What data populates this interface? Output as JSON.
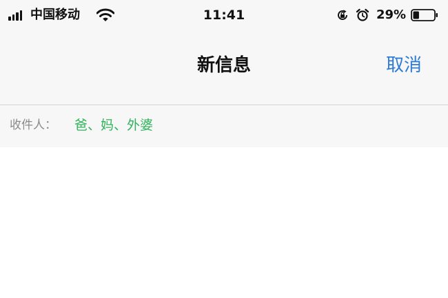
{
  "status_bar": {
    "carrier": "中国移动",
    "time": "11:41",
    "battery_percent": "29%",
    "battery_level": 0.29,
    "icons": [
      "signal-icon",
      "wifi-icon",
      "rotation-lock-icon",
      "alarm-icon",
      "battery-icon"
    ]
  },
  "nav": {
    "title": "新信息",
    "cancel_label": "取消"
  },
  "compose": {
    "to_label": "收件人：",
    "recipients": "爸、妈、外婆"
  },
  "colors": {
    "accent": "#2d7bd6",
    "recipient": "#2fb35a",
    "bar_background": "#f7f7f7"
  }
}
